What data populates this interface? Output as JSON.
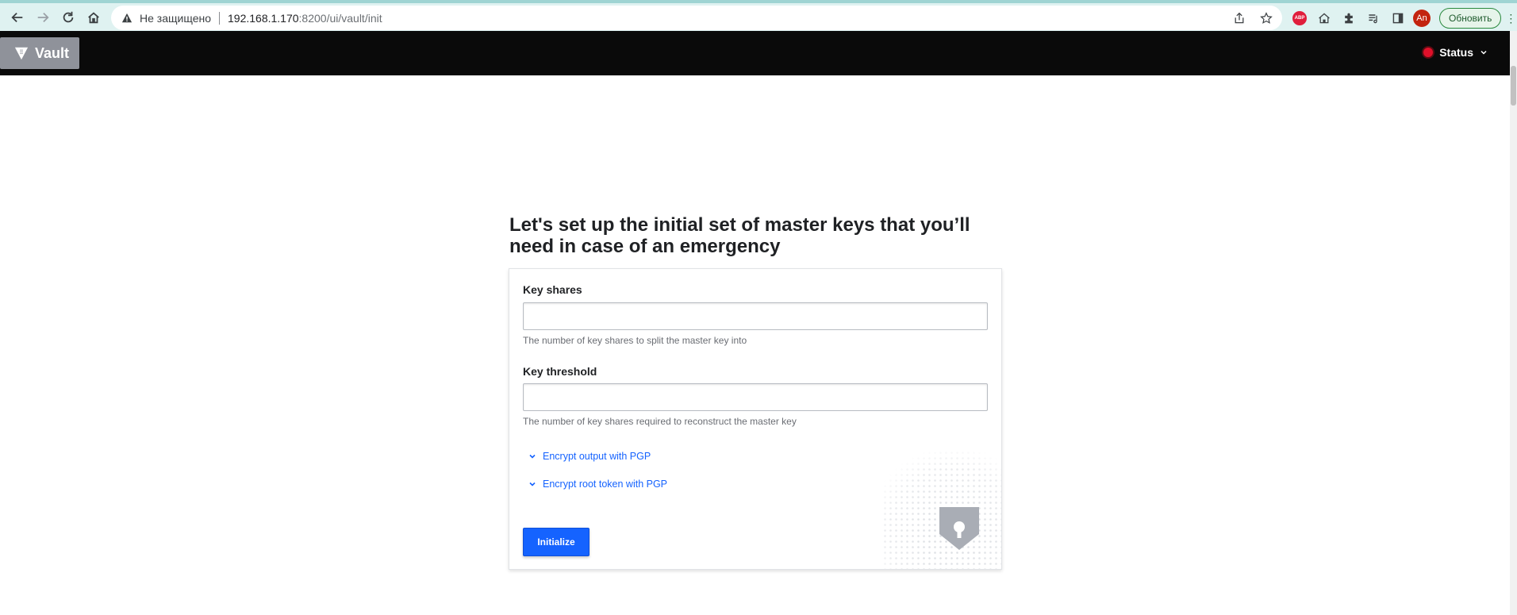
{
  "browser": {
    "not_secure": "Не защищено",
    "url_host": "192.168.1.170",
    "url_rest": ":8200/ui/vault/init",
    "update_label": "Обновить",
    "profile_initials": "An",
    "abp_text": "ABP"
  },
  "header": {
    "logo_text": "Vault",
    "status_label": "Status",
    "status_color": "#e0102a"
  },
  "page": {
    "title": "Let's set up the initial set of master keys that you’ll need in case of an emergency"
  },
  "form": {
    "key_shares_label": "Key shares",
    "key_shares_value": "",
    "key_shares_help": "The number of key shares to split the master key into",
    "key_threshold_label": "Key threshold",
    "key_threshold_value": "",
    "key_threshold_help": "The number of key shares required to reconstruct the master key",
    "toggle_encrypt_output": "Encrypt output with PGP",
    "toggle_encrypt_root": "Encrypt root token with PGP",
    "submit_label": "Initialize"
  },
  "colors": {
    "accent": "#1563ff",
    "header_bg": "#0a0a0a",
    "logo_bg": "#8f929a"
  }
}
